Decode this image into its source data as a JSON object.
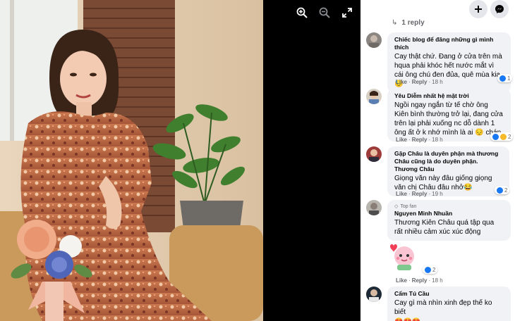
{
  "viewer": {
    "icons": [
      "zoom-in-icon",
      "zoom-out-icon",
      "fullscreen-icon"
    ]
  },
  "panel": {
    "header_icons": [
      "plus-icon",
      "messenger-icon"
    ],
    "previous_replies": "1 reply",
    "comments": [
      {
        "name": "Chiếc blog để đăng những gì mình thích",
        "text": "Cay thật chứ. Đang ở cửa trên mà hqua phải khóc hết nước mắt vì cái ông chú đen đủa, quê mùa kia 😓",
        "like": "Like",
        "reply": "Reply",
        "time": "18 h",
        "reactions": "1"
      },
      {
        "name": "Yêu Diễm nhất hệ mặt trời",
        "text": "Ngồi ngay ngắn từ tế chờ ông Kiên bình thường trở lại, đang cửa trên lại phải xuống nc dỗ dành 1 ông ất ở k nhớ mình là ai 😔 chán",
        "like": "Like",
        "reply": "Reply",
        "time": "18 h",
        "reactions": "2"
      },
      {
        "name": "Gặp Châu là duyên phận mà thương Châu cũng là do duyên phận. Thương Châu",
        "text": "Giọng văn này đâu giống giọng văn chị Châu đâu nhở😂",
        "like": "Like",
        "reply": "Reply",
        "time": "19 h",
        "reactions": "2"
      },
      {
        "badge": "Top fan",
        "name": "Nguyen Minh Nhuần",
        "text": "Thương Kiên Châu quá tập qua rất nhiều cảm xúc xúc động",
        "like": "Like",
        "reply": "Reply",
        "time": "18 h",
        "reactions": "2"
      },
      {
        "name": "Cẩm Tú Cầu",
        "text": "Cay gì mà nhìn xinh đẹp thế ko biết",
        "emoji": "😍😍😍"
      }
    ]
  },
  "colors": {
    "panel_bg": "#ffffff",
    "bubble_bg": "#f0f2f5",
    "muted_text": "#65676b",
    "like_blue": "#1877f2",
    "haha_yellow": "#f7b928",
    "love_red": "#f33e58"
  }
}
